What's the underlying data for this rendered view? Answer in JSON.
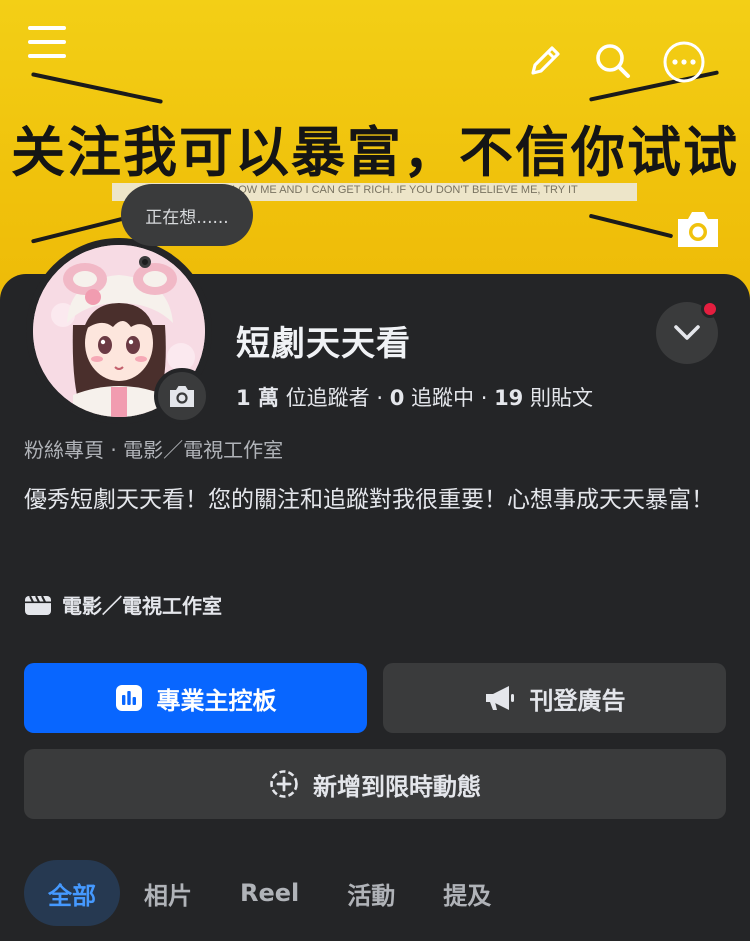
{
  "cover": {
    "headline": "关注我可以暴富，不信你试试",
    "subtext": "IF YOU FOLLOW ME AND I CAN GET RICH. IF YOU DON'T BELIEVE ME, TRY IT",
    "background_color": "#f0c20c"
  },
  "top_icons": [
    "menu-icon",
    "pencil-icon",
    "search-icon",
    "more-icon"
  ],
  "thought_bubble": "正在想......",
  "page": {
    "name": "短劇天天看",
    "followers_count": "1 萬",
    "followers_label": "位追蹤者",
    "following_count": "0",
    "following_label": "追蹤中",
    "posts_count": "19",
    "posts_label": "則貼文",
    "category_line": "粉絲專頁 · 電影／電視工作室",
    "bio": "優秀短劇天天看！您的關注和追蹤對我很重要！心想事成天天暴富！",
    "detail_category": "電影／電視工作室"
  },
  "buttons": {
    "dashboard": "專業主控板",
    "ads": "刊登廣告",
    "add_story": "新增到限時動態"
  },
  "tabs": [
    "全部",
    "相片",
    "Reel",
    "活動",
    "提及"
  ],
  "colors": {
    "primary": "#0866ff",
    "card_bg": "#242527",
    "button_bg": "#3a3b3c",
    "notification": "#e41e3f",
    "tab_active_text": "#4599ff"
  }
}
